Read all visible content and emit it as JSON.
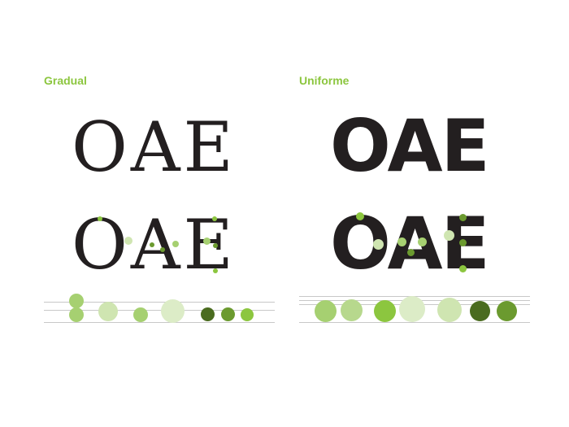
{
  "panels": {
    "left": {
      "title": "Gradual",
      "word_top": "OAE",
      "word_bottom": "OAE"
    },
    "right": {
      "title": "Uniforme",
      "word_top": "OAE",
      "word_bottom": "OAE"
    }
  },
  "colors": {
    "title": "#8cc63f",
    "glyph": "#231f20",
    "green_light": "#a6d071",
    "green_pale": "#cfe5b1",
    "green_bright": "#8cc63f",
    "green_mid": "#6b9a2f",
    "green_dark": "#4a6b1f"
  }
}
